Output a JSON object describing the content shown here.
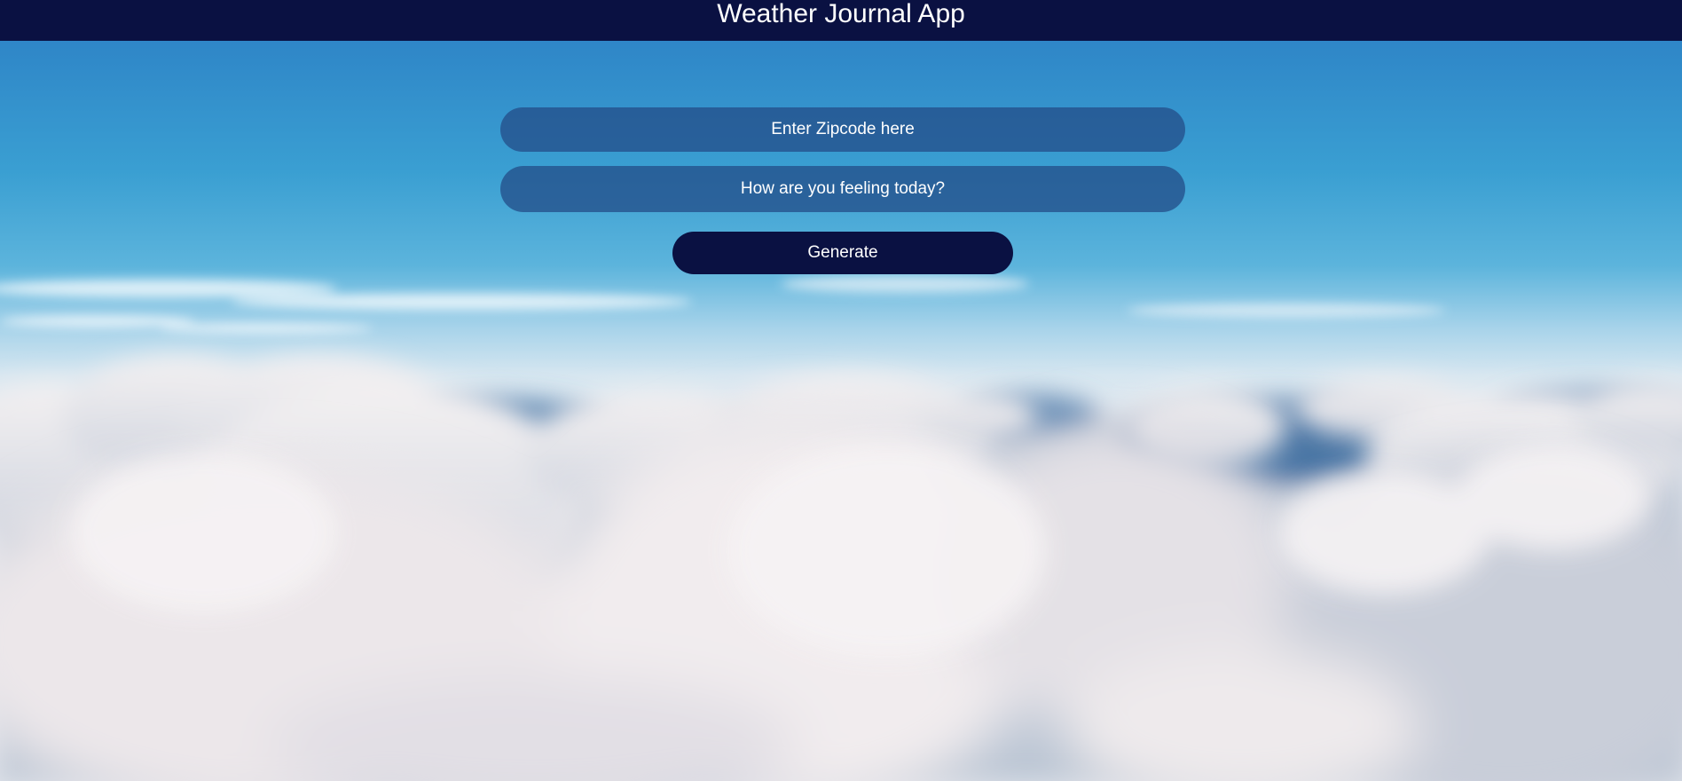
{
  "header": {
    "title": "Weather Journal App"
  },
  "form": {
    "zip_placeholder": "Enter Zipcode here",
    "feelings_placeholder": "How are you feeling today?",
    "generate_label": "Generate"
  },
  "colors": {
    "header_bg": "#0a1142",
    "button_bg": "#0a1142",
    "field_bg": "#24508a",
    "text": "#ffffff"
  }
}
